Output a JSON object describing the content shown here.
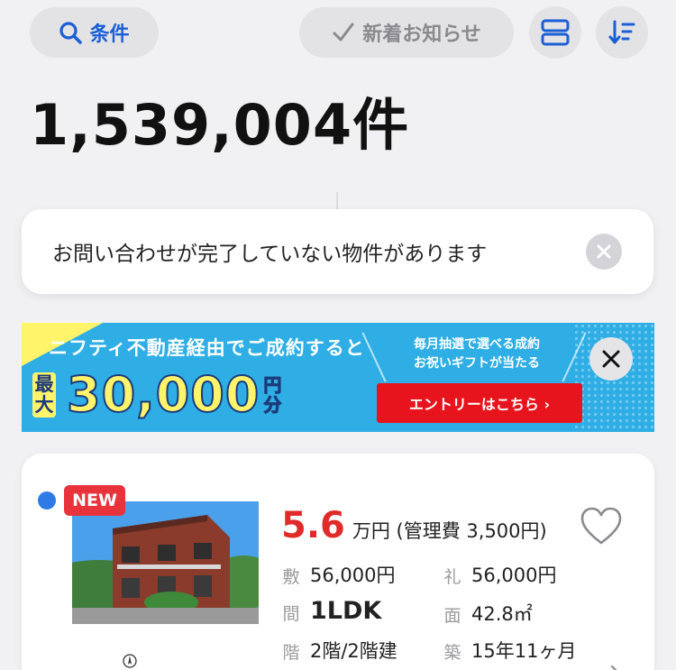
{
  "toolbar": {
    "conditions_label": "条件",
    "news_label": "新着お知らせ"
  },
  "results": {
    "count": "1,539,004件"
  },
  "toast": {
    "message": "お問い合わせが完了していない物件があります"
  },
  "banner": {
    "headline": "ニフティ不動産経由でご成約すると",
    "max_label": "最大",
    "amount": "30,000",
    "yen_label": "円分",
    "lottery_line1": "毎月抽選で選べる成約",
    "lottery_line2": "お祝いギフトが当たる",
    "entry_label": "エントリーはこちら ›",
    "colors": {
      "background": "#2eaee5",
      "yellow": "#fff46a",
      "entry": "#e8141d"
    }
  },
  "listing": {
    "badge": "NEW",
    "price_value": "5.6",
    "price_rest": "万円 (管理費 3,500円)",
    "specs": [
      {
        "key": "敷",
        "value": "56,000円"
      },
      {
        "key": "礼",
        "value": "56,000円"
      },
      {
        "key": "間",
        "value": "1LDK"
      },
      {
        "key": "面",
        "value": "42.8㎡"
      },
      {
        "key": "階",
        "value": "2階/2階建"
      },
      {
        "key": "築",
        "value": "15年11ヶ月"
      }
    ],
    "colors": {
      "price": "#e02b2b",
      "new_badge": "#e8323c",
      "unread_dot": "#2f7be6"
    }
  },
  "icons": [
    "search-icon",
    "check-icon",
    "layout-toggle-icon",
    "sort-icon",
    "close-icon",
    "heart-icon",
    "chevron-right-icon",
    "compass-icon"
  ]
}
